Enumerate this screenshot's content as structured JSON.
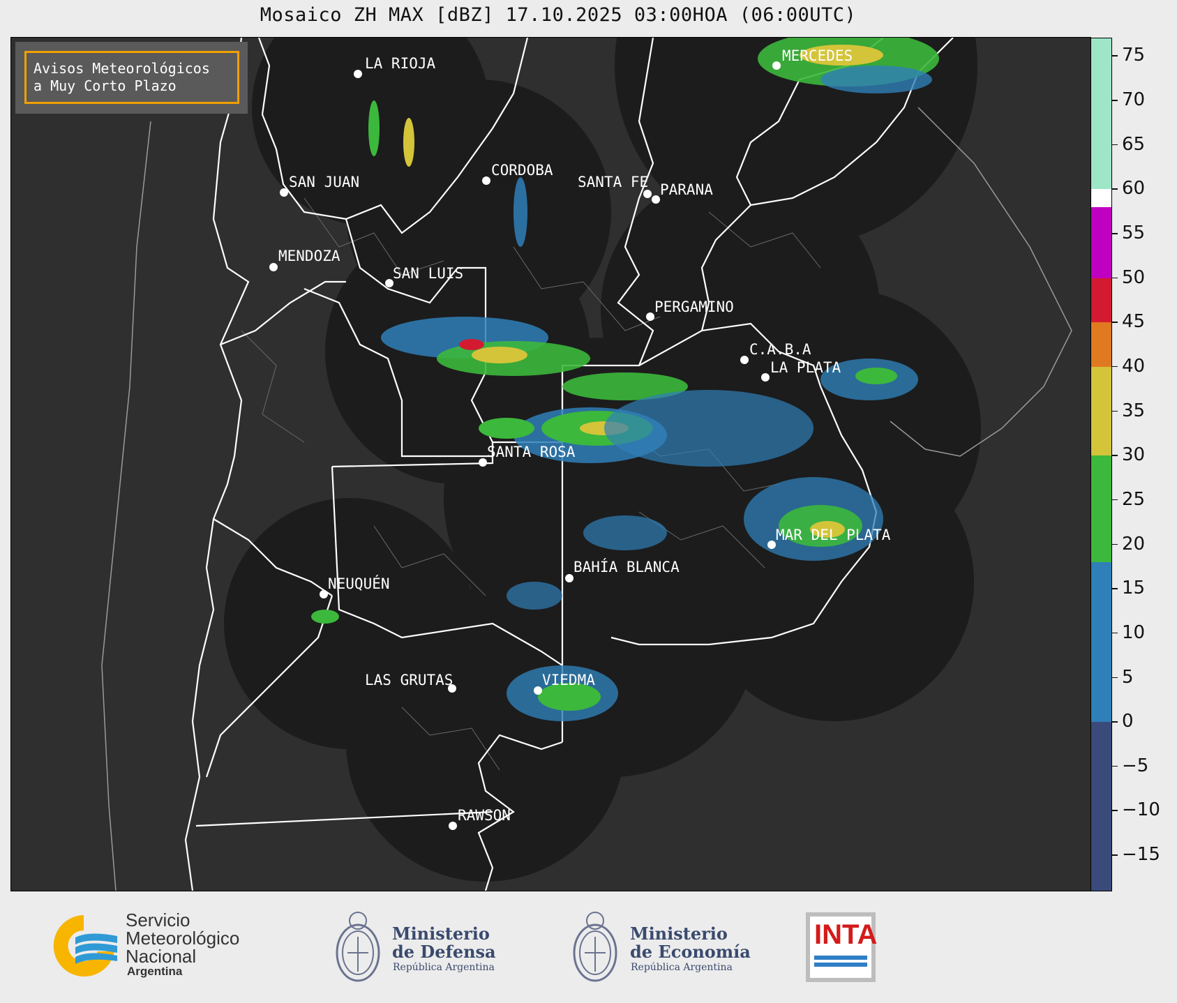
{
  "title": "Mosaico ZH MAX [dBZ] 17.10.2025 03:00HOA (06:00UTC)",
  "notice": {
    "line1": "Avisos Meteorológicos",
    "line2": "a Muy Corto Plazo",
    "border_color": "#f0a000"
  },
  "cities": [
    {
      "name": "LA RIOJA"
    },
    {
      "name": "MERCEDES"
    },
    {
      "name": "CORDOBA"
    },
    {
      "name": "SAN JUAN"
    },
    {
      "name": "SANTA FE"
    },
    {
      "name": "PARANA"
    },
    {
      "name": "MENDOZA"
    },
    {
      "name": "SAN LUIS"
    },
    {
      "name": "PERGAMINO"
    },
    {
      "name": "C.A.B.A"
    },
    {
      "name": "LA PLATA"
    },
    {
      "name": "SANTA ROSA"
    },
    {
      "name": "MAR DEL PLATA"
    },
    {
      "name": "BAHÍA BLANCA"
    },
    {
      "name": "NEUQUÉN"
    },
    {
      "name": "LAS GRUTAS"
    },
    {
      "name": "VIEDMA"
    },
    {
      "name": "RAWSON"
    }
  ],
  "colorbar": {
    "unit": "dBZ",
    "min": -19,
    "max": 77,
    "ticks": [
      "75",
      "70",
      "65",
      "60",
      "55",
      "50",
      "45",
      "40",
      "35",
      "30",
      "25",
      "20",
      "15",
      "10",
      "5",
      "0",
      "−5",
      "−10",
      "−15"
    ],
    "tick_values": [
      75,
      70,
      65,
      60,
      55,
      50,
      45,
      40,
      35,
      30,
      25,
      20,
      15,
      10,
      5,
      0,
      -5,
      -10,
      -15
    ],
    "bands": [
      {
        "from": -19,
        "to": 0,
        "color": "#3a4a7a"
      },
      {
        "from": 0,
        "to": 18,
        "color": "#2f7fb8"
      },
      {
        "from": 18,
        "to": 30,
        "color": "#3cb83c"
      },
      {
        "from": 30,
        "to": 40,
        "color": "#d4c43a"
      },
      {
        "from": 40,
        "to": 45,
        "color": "#e07a20"
      },
      {
        "from": 45,
        "to": 50,
        "color": "#d41a30"
      },
      {
        "from": 50,
        "to": 58,
        "color": "#c000c0"
      },
      {
        "from": 58,
        "to": 60,
        "color": "#ffffff"
      },
      {
        "from": 60,
        "to": 77,
        "color": "#9ee6c8"
      }
    ]
  },
  "footer": {
    "smn": {
      "line1": "Servicio",
      "line2": "Meteorológico",
      "line3": "Nacional",
      "line4": "Argentina"
    },
    "defensa": {
      "line1": "Ministerio",
      "line2": "de Defensa",
      "line3": "República Argentina"
    },
    "economia": {
      "line1": "Ministerio",
      "line2": "de Economía",
      "line3": "República Argentina"
    },
    "inta": {
      "text": "INTA"
    }
  }
}
